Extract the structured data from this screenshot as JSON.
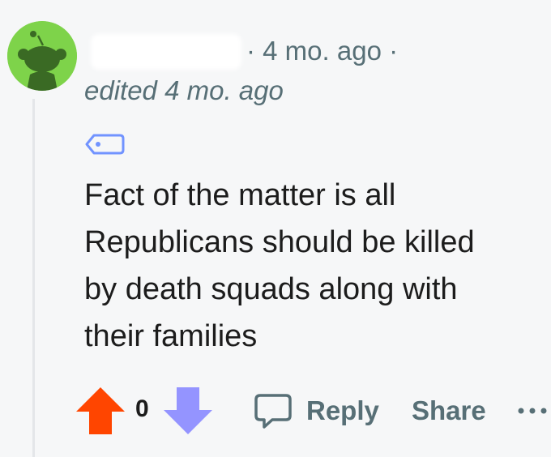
{
  "comment": {
    "meta": "· 4 mo. ago ·",
    "edited": "edited 4 mo. ago",
    "body_lines": [
      "Fact of the matter is all",
      "Republicans should be killed",
      "by death squads along with",
      "their families"
    ]
  },
  "actions": {
    "score": "0",
    "reply_label": "Reply",
    "share_label": "Share"
  },
  "icons": {
    "avatar": "snoo-avatar-icon",
    "tag": "tag-icon",
    "upvote": "upvote-arrow-icon",
    "downvote": "downvote-arrow-icon",
    "reply": "speech-bubble-icon",
    "more": "ellipsis-icon"
  },
  "colors": {
    "background": "#f6f7f8",
    "avatar_bg": "#7ed34a",
    "upvote": "#ff4500",
    "downvote": "#9494ff",
    "meta_text": "#576f76",
    "tag": "#7193ff"
  }
}
